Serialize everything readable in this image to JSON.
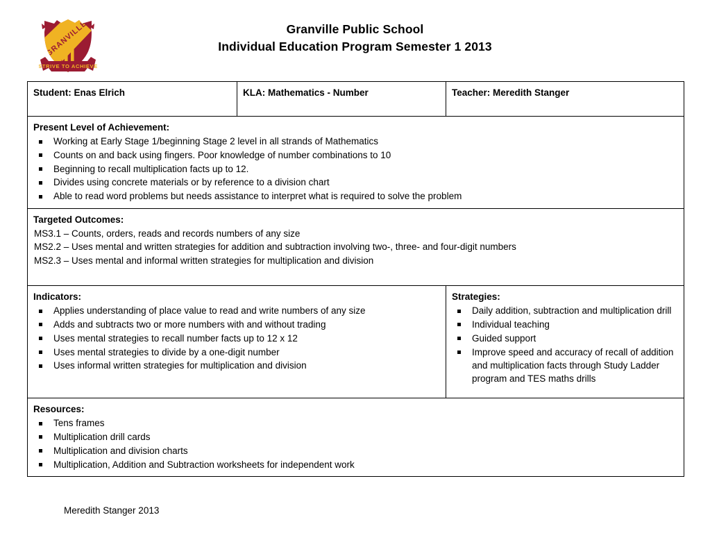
{
  "header": {
    "logo_alt": "Granville Public School crest",
    "crest": {
      "name_text": "GRANVILLE",
      "motto_text": "STRIVE TO ACHIEVE",
      "shield_color": "#9B1B32",
      "band_color": "#F0B323",
      "stripe_color": "#F0B323",
      "banner_color": "#9B1B32"
    },
    "title_line1": "Granville Public School",
    "title_line2": "Individual Education Program Semester 1 2013"
  },
  "info_row": {
    "student": "Student:  Enas Elrich",
    "kla": "KLA:  Mathematics - Number",
    "teacher": "Teacher:  Meredith Stanger"
  },
  "present_level": {
    "heading": "Present Level of Achievement:",
    "items": [
      "Working at Early Stage 1/beginning Stage 2 level in all strands of Mathematics",
      "Counts on and back using fingers. Poor knowledge of number combinations to 10",
      "Beginning to recall multiplication facts up to 12.",
      "Divides using concrete materials or by reference to a division chart",
      "Able to read word problems but needs assistance to interpret what is required to solve the problem"
    ]
  },
  "targeted_outcomes": {
    "heading": "Targeted Outcomes:",
    "lines": [
      "MS3.1 – Counts, orders, reads and records numbers of any size",
      "MS2.2 – Uses mental and written strategies for addition and subtraction involving two-, three- and four-digit numbers",
      "MS2.3 – Uses mental and informal written strategies for multiplication and division"
    ]
  },
  "indicators": {
    "heading": "Indicators:",
    "items": [
      "Applies understanding of place value to read and write numbers of any size",
      "Adds and subtracts  two or more numbers with and without trading",
      "Uses mental strategies to recall number facts up to 12 x 12",
      "Uses mental strategies to divide by a one-digit number",
      "Uses informal written strategies for multiplication and division"
    ]
  },
  "strategies": {
    "heading": "Strategies:",
    "items": [
      "Daily addition, subtraction and multiplication drill",
      "Individual teaching",
      "Guided support",
      "Improve speed and accuracy of recall of addition and multiplication facts through Study Ladder program and TES maths drills"
    ]
  },
  "resources": {
    "heading": "Resources:",
    "items": [
      "Tens frames",
      "Multiplication drill cards",
      "Multiplication and division charts",
      "Multiplication, Addition and Subtraction worksheets for independent work"
    ]
  },
  "footer": {
    "note": "Meredith Stanger 2013"
  }
}
